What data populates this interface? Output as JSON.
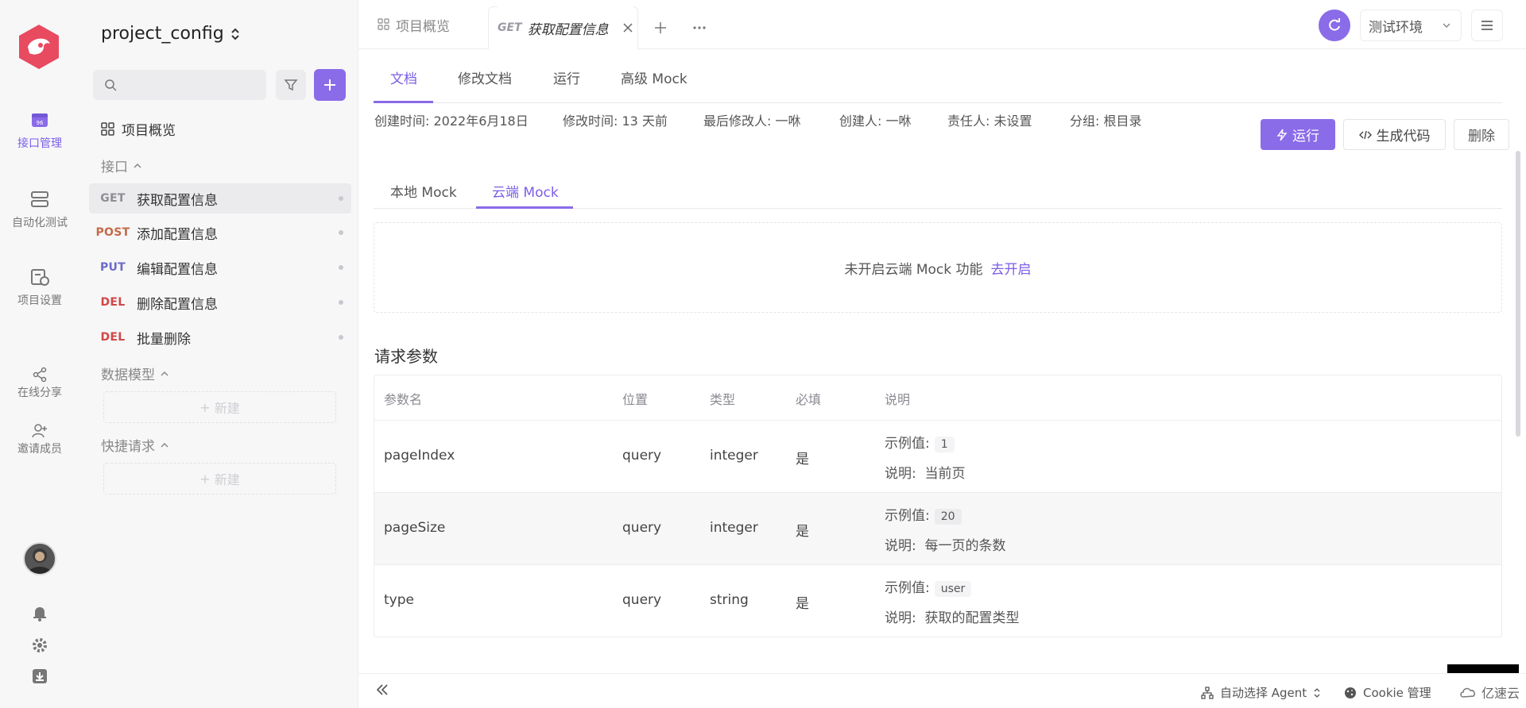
{
  "rail": {
    "items": [
      {
        "label": "接口管理",
        "icon": "api-management-icon",
        "active": true
      },
      {
        "label": "自动化测试",
        "icon": "automation-test-icon"
      },
      {
        "label": "项目设置",
        "icon": "project-settings-icon"
      },
      {
        "label": "在线分享",
        "icon": "share-icon"
      },
      {
        "label": "邀请成员",
        "icon": "invite-member-icon"
      }
    ]
  },
  "sidebar": {
    "project_name": "project_config",
    "search_placeholder": "",
    "overview_label": "项目概览",
    "sections": {
      "interfaces": "接口",
      "data_models": "数据模型",
      "quick_requests": "快捷请求"
    },
    "apis": [
      {
        "method": "GET",
        "name": "获取配置信息"
      },
      {
        "method": "POST",
        "name": "添加配置信息"
      },
      {
        "method": "PUT",
        "name": "编辑配置信息"
      },
      {
        "method": "DEL",
        "name": "删除配置信息"
      },
      {
        "method": "DEL",
        "name": "批量删除"
      }
    ],
    "new_label": "新建"
  },
  "tabs": {
    "overview": "项目概览",
    "active_method": "GET",
    "active_name": "获取配置信息"
  },
  "env": {
    "selected": "测试环境"
  },
  "subtabs": [
    "文档",
    "修改文档",
    "运行",
    "高级 Mock"
  ],
  "meta": {
    "created": "创建时间: 2022年6月18日",
    "modified": "修改时间: 13 天前",
    "last_modifier": "最后修改人: 一咻",
    "creator": "创建人: 一咻",
    "owner": "责任人: 未设置",
    "group": "分组: 根目录"
  },
  "actions": {
    "run": "运行",
    "gen_code": "生成代码",
    "delete": "删除"
  },
  "mock": {
    "tabs": [
      "本地 Mock",
      "云端 Mock"
    ],
    "message": "未开启云端 Mock 功能",
    "enable_link": "去开启"
  },
  "params": {
    "title": "请求参数",
    "headers": [
      "参数名",
      "位置",
      "类型",
      "必填",
      "说明"
    ],
    "example_label": "示例值:",
    "desc_label": "说明:",
    "rows": [
      {
        "name": "pageIndex",
        "in": "query",
        "type": "integer",
        "required": "是",
        "example": "1",
        "desc": "当前页"
      },
      {
        "name": "pageSize",
        "in": "query",
        "type": "integer",
        "required": "是",
        "example": "20",
        "desc": "每一页的条数"
      },
      {
        "name": "type",
        "in": "query",
        "type": "string",
        "required": "是",
        "example": "user",
        "desc": "获取的配置类型"
      }
    ]
  },
  "bottom": {
    "agent": "自动选择 Agent",
    "cookie": "Cookie 管理",
    "watermark": "亿速云"
  },
  "colors": {
    "accent": "#8a6be8",
    "post": "#c56b47",
    "put": "#6b6bc8",
    "del": "#d04747"
  }
}
